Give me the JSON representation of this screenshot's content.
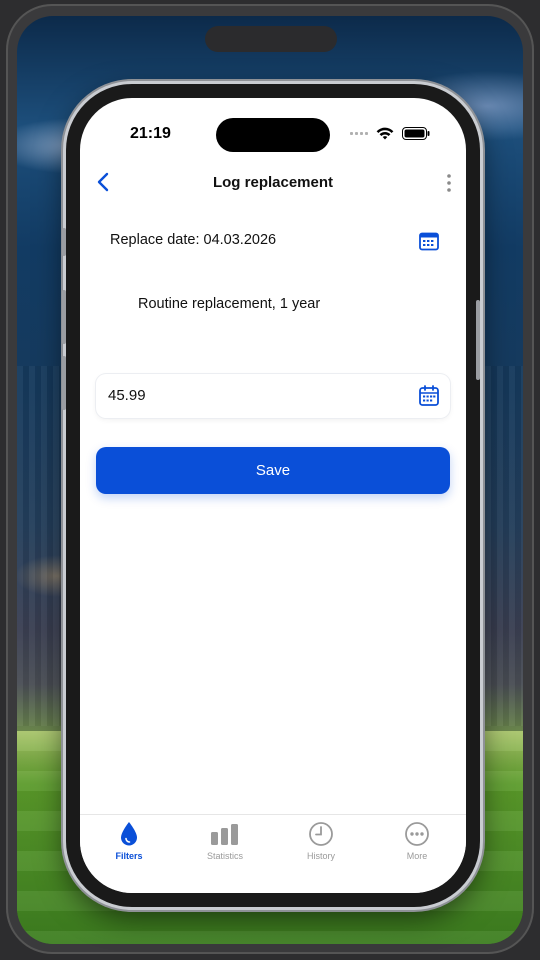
{
  "status_bar": {
    "time": "21:19"
  },
  "navbar": {
    "title": "Log replacement",
    "back_icon": "chevron-left-icon",
    "more_icon": "vertical-ellipsis-icon"
  },
  "form": {
    "replace_date_label": "Replace date: 04.03.2026",
    "note": "Routine replacement, 1 year",
    "price_value": "45.99",
    "save_label": "Save"
  },
  "tabbar": {
    "items": [
      {
        "label": "Filters",
        "icon": "water-drop-icon",
        "active": true
      },
      {
        "label": "Statistics",
        "icon": "bar-chart-icon",
        "active": false
      },
      {
        "label": "History",
        "icon": "clock-icon",
        "active": false
      },
      {
        "label": "More",
        "icon": "more-circle-icon",
        "active": false
      }
    ]
  },
  "colors": {
    "accent": "#0a4fd8",
    "inactive": "#9a9a9a",
    "text": "#111111"
  }
}
